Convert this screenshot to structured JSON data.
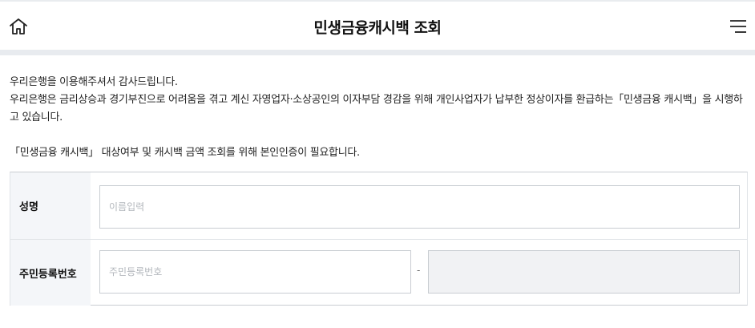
{
  "header": {
    "title": "민생금융캐시백 조회"
  },
  "intro": {
    "line1": "우리은행을 이용해주셔서 감사드립니다.",
    "line2": "우리은행은 금리상승과 경기부진으로 어려움을 겪고 계신 자영업자·소상공인의 이자부담 경감을 위해 개인사업자가 납부한 정상이자를 환급하는「민생금융 캐시백」을 시행하고 있습니다.",
    "notice": "「민생금융 캐시백」 대상여부 및 캐시백 금액 조회를 위해 본인인증이 필요합니다."
  },
  "form": {
    "name_label": "성명",
    "name_placeholder": "이름입력",
    "rrn_label": "주민등록번호",
    "rrn_placeholder": "주민등록번호",
    "rrn_separator": "-"
  },
  "icons": {
    "home": "home-icon",
    "menu": "hamburger-menu-icon"
  }
}
